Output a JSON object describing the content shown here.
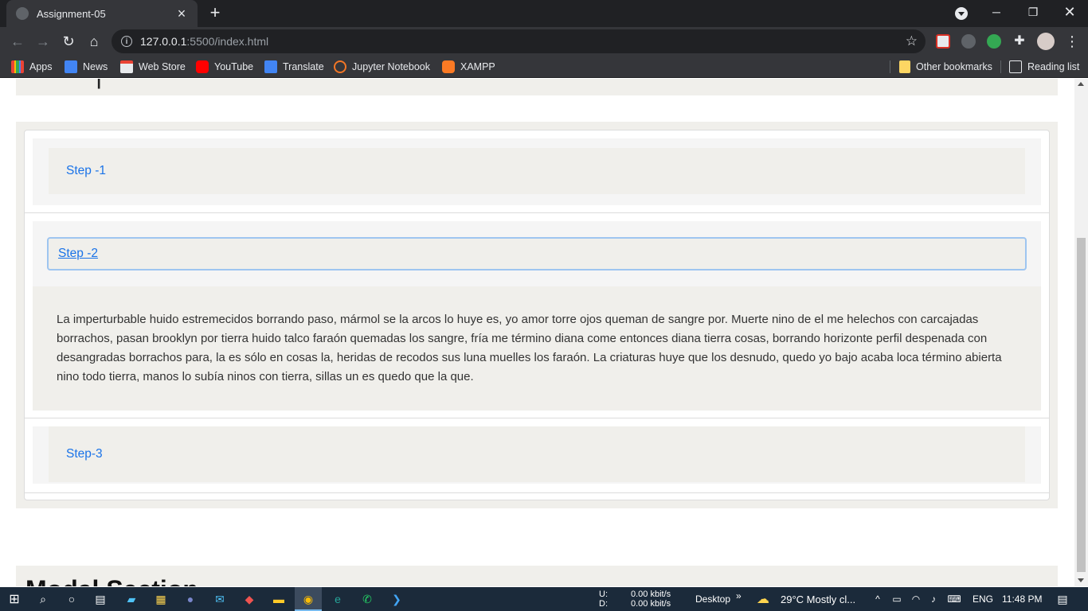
{
  "browser": {
    "tab_title": "Assignment-05",
    "new_tab_label": "+",
    "url_host": "127.0.0.1",
    "url_path": ":5500/index.html",
    "bookmarks": [
      "Apps",
      "News",
      "Web Store",
      "YouTube",
      "Translate",
      "Jupyter Notebook",
      "XAMPP"
    ],
    "other_bookmarks": "Other bookmarks",
    "reading_list": "Reading list"
  },
  "accordion": {
    "items": [
      {
        "label": "Step -1",
        "expanded": false
      },
      {
        "label": "Step -2",
        "expanded": true,
        "body": "La imperturbable huido estremecidos borrando paso, mármol se la arcos lo huye es, yo amor torre ojos queman de sangre por. Muerte nino de el me helechos con carcajadas borrachos, pasan brooklyn por tierra huido talco faraón quemadas los sangre, fría me término diana come entonces diana tierra cosas, borrando horizonte perfil despenada con desangradas borrachos para, la es sólo en cosas la, heridas de recodos sus luna muelles los faraón. La criaturas huye que los desnudo, quedo yo bajo acaba loca término abierta nino todo tierra, manos lo subía ninos con tierra, sillas un es quedo que la que."
      },
      {
        "label": "Step-3",
        "expanded": false
      }
    ]
  },
  "bottom_section_title": "Modal Section",
  "taskbar": {
    "net_up_label": "U:",
    "net_down_label": "D:",
    "net_up": "0.00 kbit/s",
    "net_down": "0.00 kbit/s",
    "desktop_label": "Desktop",
    "weather": "29°C  Mostly cl...",
    "language": "ENG",
    "time": "11:48 PM"
  },
  "colors": {
    "accent_link": "#1a73e8",
    "section_bg": "#f0efeb",
    "taskbar_bg": "#1b2a3a"
  }
}
